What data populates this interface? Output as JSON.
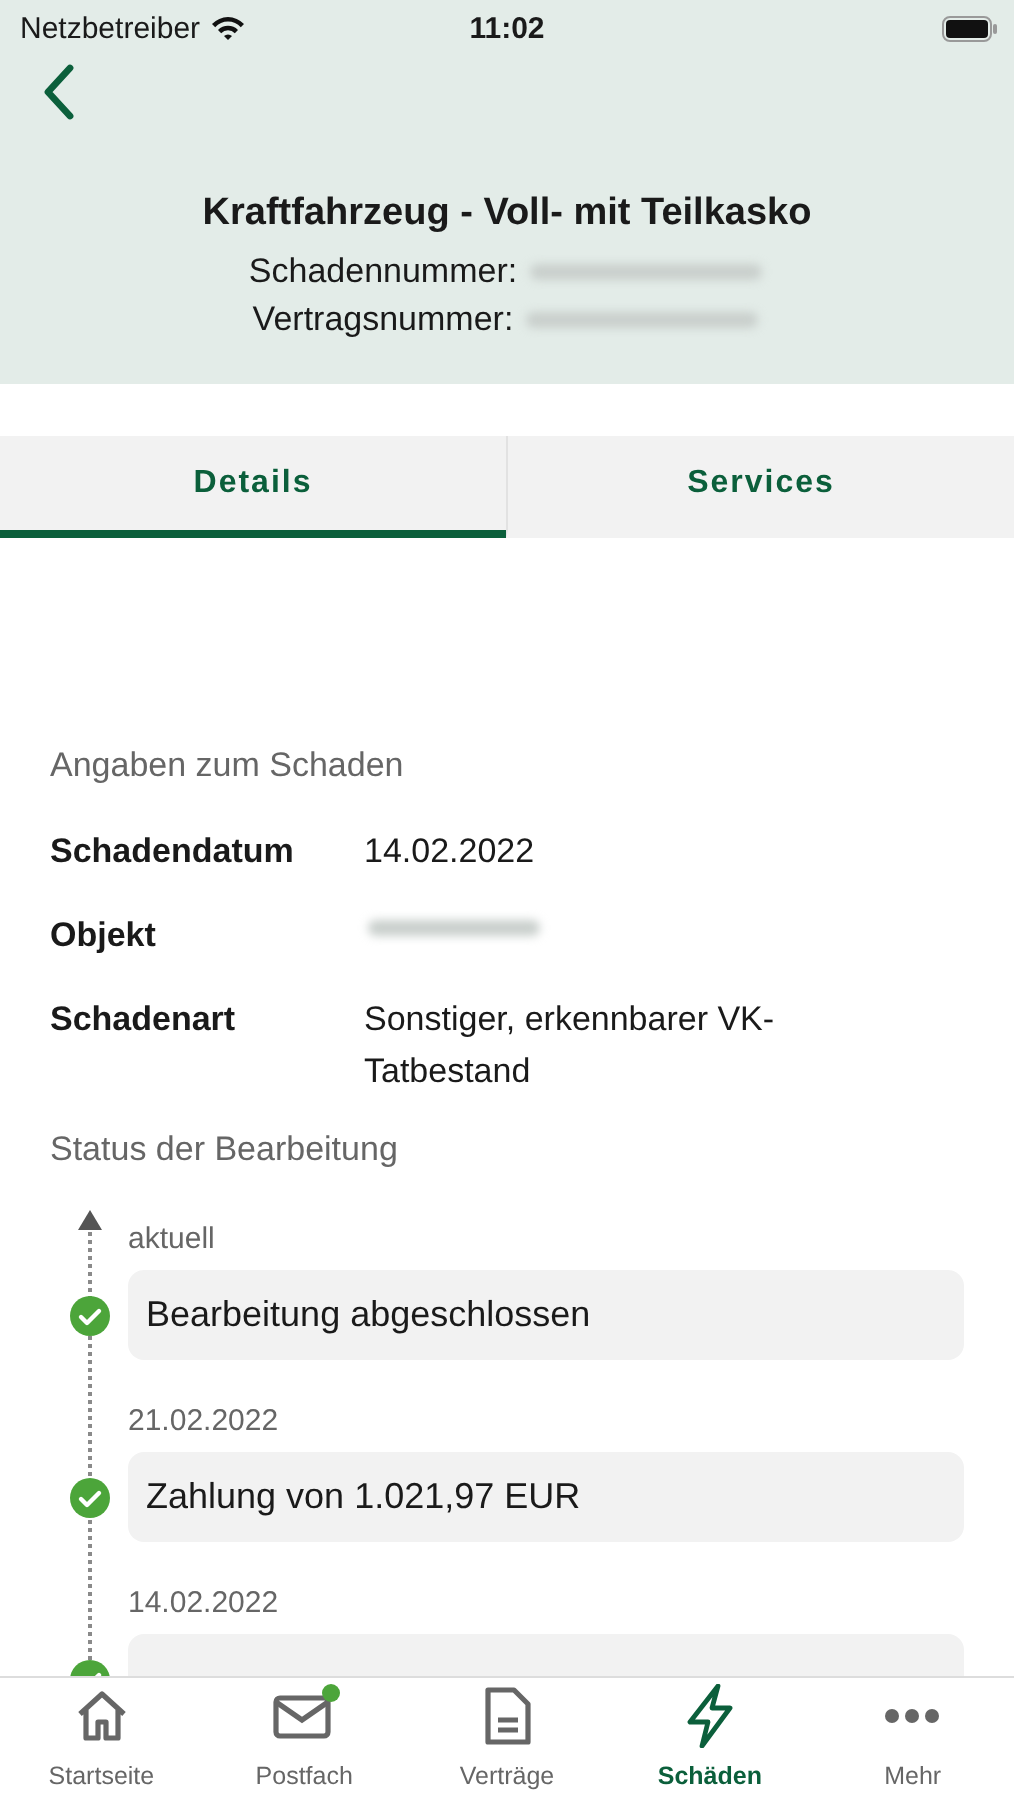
{
  "status_bar": {
    "carrier": "Netzbetreiber",
    "time": "11:02"
  },
  "header": {
    "title": "Kraftfahrzeug - Voll- mit Teilkasko",
    "fields": [
      {
        "label": "Schadennummer:",
        "redacted": true
      },
      {
        "label": "Vertragsnummer:",
        "redacted": true
      }
    ]
  },
  "tabs": [
    {
      "label": "Details",
      "selected": true
    },
    {
      "label": "Services",
      "selected": false
    }
  ],
  "details": {
    "heading": "Angaben zum Schaden",
    "rows": [
      {
        "label": "Schadendatum",
        "value": "14.02.2022",
        "redacted": false
      },
      {
        "label": "Objekt",
        "redacted": true
      },
      {
        "label": "Schadenart",
        "value": "Sonstiger, erkennbarer VK-Tatbestand",
        "redacted": false
      }
    ]
  },
  "status": {
    "heading": "Status der Bearbeitung",
    "items": [
      {
        "date": "aktuell",
        "text": "Bearbeitung abgeschlossen",
        "done": true
      },
      {
        "date": "21.02.2022",
        "text": "Zahlung von 1.021,97 EUR",
        "done": true
      },
      {
        "date": "14.02.2022",
        "done": true
      }
    ]
  },
  "tab_bar": [
    {
      "label": "Startseite",
      "kind": "home",
      "selected": false,
      "unread": false
    },
    {
      "label": "Postfach",
      "kind": "mail",
      "selected": false,
      "unread": true
    },
    {
      "label": "Verträge",
      "kind": "doc",
      "selected": false,
      "unread": false
    },
    {
      "label": "Schäden",
      "kind": "bolt",
      "selected": true,
      "unread": false
    },
    {
      "label": "Mehr",
      "kind": "more",
      "selected": false,
      "unread": false
    }
  ]
}
